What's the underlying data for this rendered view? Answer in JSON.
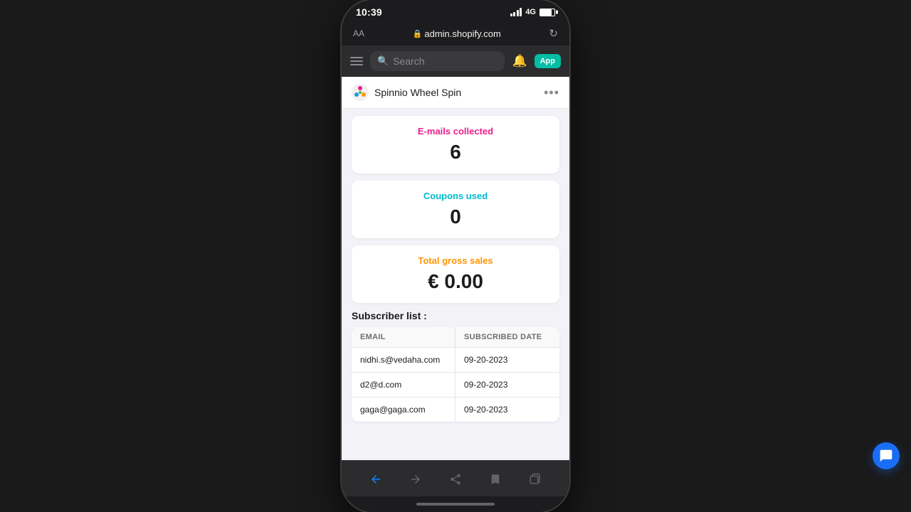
{
  "statusBar": {
    "time": "10:39",
    "signal": "4G"
  },
  "addressBar": {
    "aa": "AA",
    "url": "admin.shopify.com"
  },
  "browserToolbar": {
    "search_placeholder": "Search",
    "app_badge": "App"
  },
  "appHeader": {
    "name": "Spinnio Wheel Spin"
  },
  "stats": {
    "emails_label": "E-mails collected",
    "emails_value": "6",
    "coupons_label": "Coupons used",
    "coupons_value": "0",
    "sales_label": "Total gross sales",
    "sales_value": "€ 0.00"
  },
  "subscriberSection": {
    "title": "Subscriber list :",
    "columns": [
      "EMAIL",
      "SUBSCRIBED DATE"
    ],
    "rows": [
      {
        "email": "nidhi.s@vedaha.com",
        "date": "09-20-2023"
      },
      {
        "email": "d2@d.com",
        "date": "09-20-2023"
      },
      {
        "email": "gaga@gaga.com",
        "date": "09-20-2023"
      }
    ]
  }
}
